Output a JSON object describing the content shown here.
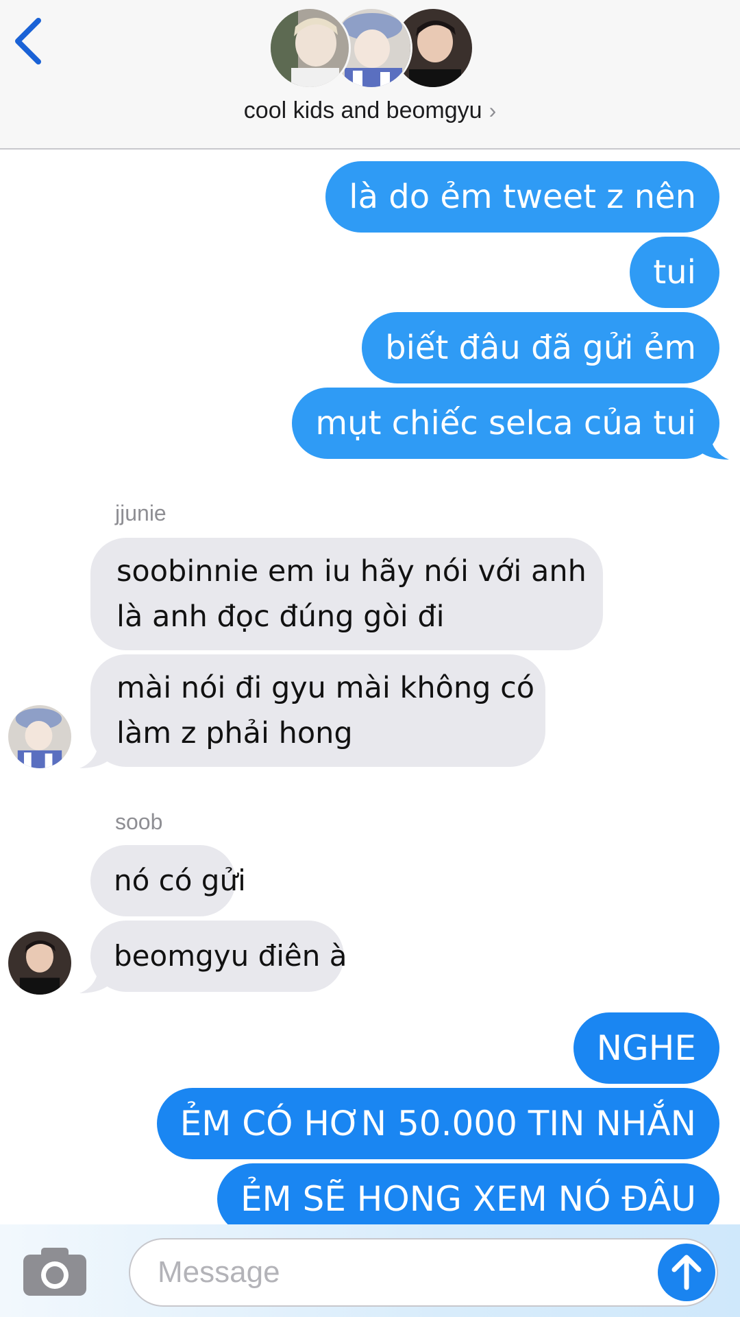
{
  "header": {
    "title": "cool kids and beomgyu",
    "chevron": "›",
    "back_icon": "chevron-left-icon",
    "avatars": [
      "avatar-1",
      "avatar-2",
      "avatar-3"
    ]
  },
  "colors": {
    "outgoing_bubble": "#2f9bf5",
    "outgoing_caps_bubble": "#1a86f2",
    "incoming_bubble": "#e8e8ed",
    "back_icon": "#1a62d6",
    "send_button": "#1a84f0"
  },
  "messages": {
    "out_1": "là do ẻm tweet z nên",
    "out_2": "tui",
    "out_3": "biết đâu đã gửi ẻm",
    "out_4": "mụt chiếc selca của tui",
    "sender_jjunie": "jjunie",
    "jjunie_1_line1": "soobinnie em iu hãy nói với anh",
    "jjunie_1_line2": "là anh đọc đúng gòi đi",
    "jjunie_2_line1": "mài nói đi gyu mài không có",
    "jjunie_2_line2": "làm z phải hong",
    "sender_soob": "soob",
    "soob_1": "nó có gửi",
    "soob_2": "beomgyu điên à",
    "out_5": "NGHE",
    "out_6": "ẺM CÓ HƠN 50.000 TIN NHẮN",
    "out_7": "ẺM SẼ HONG XEM NÓ ĐÂU"
  },
  "composer": {
    "placeholder": "Message",
    "camera_icon": "camera-icon",
    "send_icon": "arrow-up-icon"
  }
}
